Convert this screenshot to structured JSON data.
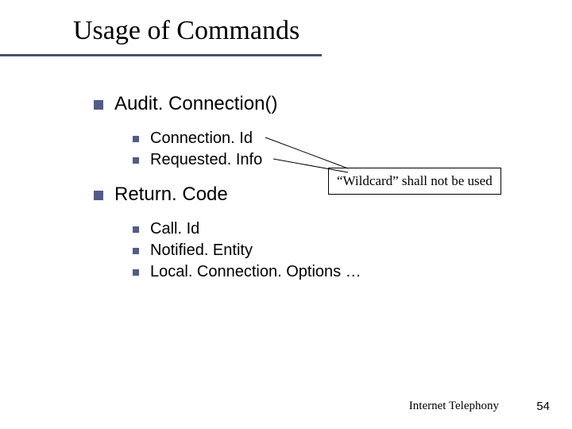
{
  "title": "Usage of Commands",
  "items": {
    "i1": "Audit. Connection()",
    "i1a": "Connection. Id",
    "i1b": "Requested. Info",
    "i2": "Return. Code",
    "i2a": "Call. Id",
    "i2b": "Notified. Entity",
    "i2c": "Local. Connection. Options …"
  },
  "callout": "“Wildcard” shall not be used",
  "footer": {
    "label": "Internet Telephony",
    "page": "54"
  }
}
